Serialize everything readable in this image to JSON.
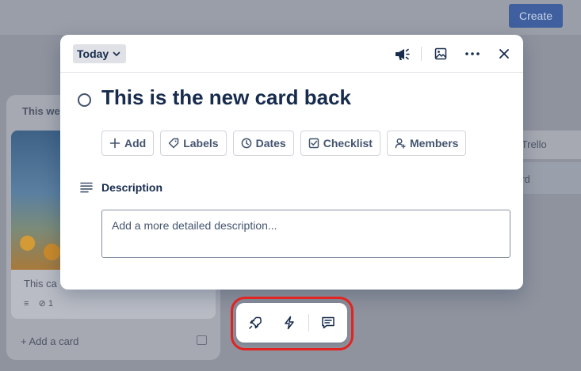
{
  "background": {
    "create_label": "Create",
    "list_title": "This we",
    "card_title": "This ca",
    "card_badge_count": "1",
    "add_card_label": "+ Add a card",
    "right_item_1": "r Trello",
    "right_item_2": "ard"
  },
  "modal": {
    "list_selector_label": "Today",
    "card_title": "This is the new card back",
    "header_icons": [
      "megaphone-icon",
      "image-icon",
      "more-icon",
      "close-icon"
    ],
    "actions": [
      {
        "label": "Add",
        "icon": "plus-icon"
      },
      {
        "label": "Labels",
        "icon": "tag-icon"
      },
      {
        "label": "Dates",
        "icon": "clock-icon"
      },
      {
        "label": "Checklist",
        "icon": "checklist-icon"
      },
      {
        "label": "Members",
        "icon": "person-icon"
      }
    ],
    "description": {
      "title": "Description",
      "placeholder": "Add a more detailed description..."
    }
  },
  "toolbar": {
    "icons": [
      "rocket-icon",
      "lightning-icon",
      "comment-icon"
    ],
    "highlight_color": "#e32420"
  },
  "colors": {
    "text_primary": "#172b4d",
    "text_subtle": "#44546f",
    "chip_bg": "#dfe1e6"
  }
}
